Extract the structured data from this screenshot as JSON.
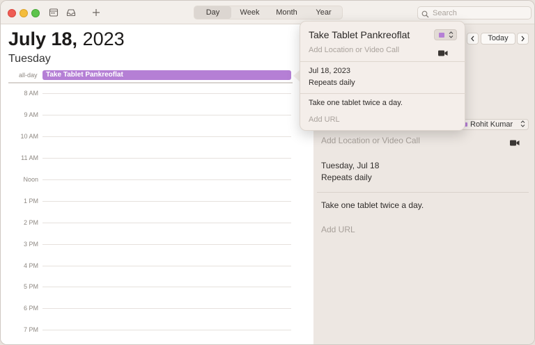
{
  "toolbar": {
    "views": [
      "Day",
      "Week",
      "Month",
      "Year"
    ],
    "selected_view": "Day",
    "search_placeholder": "Search",
    "today_label": "Today"
  },
  "day": {
    "month_day": "July 18,",
    "year": "2023",
    "weekday": "Tuesday",
    "all_day_label": "all-day",
    "all_day_event": "Take Tablet Pankreoflat",
    "hours": [
      "8 AM",
      "9 AM",
      "10 AM",
      "11 AM",
      "Noon",
      "1 PM",
      "2 PM",
      "3 PM",
      "4 PM",
      "5 PM",
      "6 PM",
      "7 PM"
    ]
  },
  "popover": {
    "title": "Take Tablet Pankreoflat",
    "location_placeholder": "Add Location or Video Call",
    "date": "Jul 18, 2023",
    "repeat": "Repeats daily",
    "notes": "Take one tablet twice a day.",
    "url_placeholder": "Add URL",
    "color": "#b57fd5"
  },
  "inspector": {
    "calendar_name": "Rohit Kumar",
    "location_placeholder": "Add Location or Video Call",
    "date": "Tuesday, Jul 18",
    "repeat": "Repeats daily",
    "notes": "Take one tablet twice a day.",
    "url_placeholder": "Add URL"
  },
  "colors": {
    "event_purple": "#b57fd5",
    "close": "#ee5d55",
    "minimize": "#f4bd3c",
    "zoom": "#5ec44d"
  }
}
